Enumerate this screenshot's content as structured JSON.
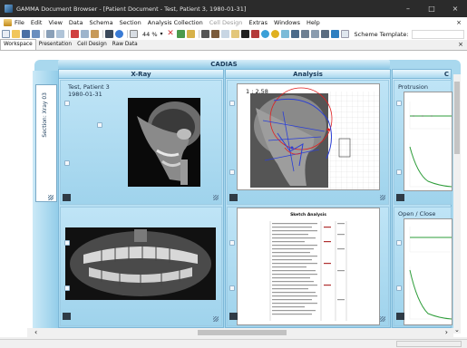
{
  "window": {
    "title": "GAMMA Document Browser - [Patient Document - Test, Patient 3, 1980-01-31]",
    "controls": [
      "–",
      "□",
      "×"
    ]
  },
  "menubar": {
    "items": [
      {
        "label": "File",
        "disabled": false
      },
      {
        "label": "Edit",
        "disabled": false
      },
      {
        "label": "View",
        "disabled": false
      },
      {
        "label": "Data",
        "disabled": false
      },
      {
        "label": "Schema",
        "disabled": false
      },
      {
        "label": "Section",
        "disabled": false
      },
      {
        "label": "Analysis Collection",
        "disabled": false
      },
      {
        "label": "Cell Design",
        "disabled": true
      },
      {
        "label": "Extras",
        "disabled": false
      },
      {
        "label": "Windows",
        "disabled": false
      },
      {
        "label": "Help",
        "disabled": false
      }
    ],
    "close_glyph": "×"
  },
  "toolbar": {
    "zoom": "44 %",
    "scheme_label": "Scheme Template:",
    "icons": [
      "new-icon",
      "open-icon",
      "save-icon",
      "print-setup-icon",
      "print-icon",
      "print-preview-icon",
      "cut-icon",
      "copy-icon",
      "paste-icon",
      "layout-icon",
      "info-icon",
      "fit-icon",
      "zoom-dropdown-icon",
      "delete-icon",
      "edit-icon",
      "lock-icon",
      "camera-icon",
      "capture-icon",
      "screen-icon",
      "tool-icon",
      "ruler-icon",
      "grid-icon",
      "color-icon",
      "circle-icon",
      "export-icon",
      "arrow-icon",
      "view1-icon",
      "view2-icon",
      "view3-icon",
      "check-icon",
      "page-icon"
    ]
  },
  "tabs": {
    "items": [
      "Workspace",
      "Presentation",
      "Cell Design",
      "Raw Data"
    ],
    "active": 0,
    "close_glyph": "×"
  },
  "document": {
    "banner": "CADIAS",
    "side_panel_label": "Section: Xray 03",
    "columns": [
      {
        "title": "X-Ray"
      },
      {
        "title": "Analysis"
      },
      {
        "title": "C"
      }
    ],
    "cells": {
      "xray_top": {
        "patient": "Test, Patient 3",
        "date": "1980-01-31"
      },
      "analysis_top": {
        "zoom": "1 : 2.58"
      },
      "analysis_bottom": {
        "heading": "Sketch Analysis"
      },
      "chart_top": {
        "label": "Protrusion"
      },
      "chart_bottom": {
        "label": "Open / Close"
      }
    }
  },
  "scrollbars": {
    "left_arrow": "‹",
    "right_arrow": "›",
    "down_arrow": "⌄"
  },
  "colors": {
    "accent": "#a9d8ee",
    "titlebar": "#2b2b2b"
  }
}
